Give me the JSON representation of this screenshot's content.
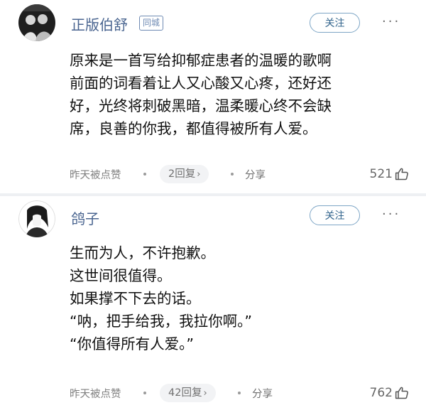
{
  "comments": [
    {
      "username": "正版伯舒",
      "badge": "同城",
      "follow_label": "关注",
      "more_icon": "more-dots-icon",
      "text_lines": [
        "原来是一首写给抑郁症患者的温暖的歌啊",
        "前面的词看着让人又心酸又心疼，还好还",
        "好，光终将刺破黑暗，温柔暖心终不会缺",
        "席，良善的你我，都值得被所有人爱。"
      ],
      "time": "昨天被点赞",
      "replies": "2回复",
      "share_label": "分享",
      "likes": "521",
      "like_icon": "thumbs-up-icon"
    },
    {
      "username": "鸽子",
      "follow_label": "关注",
      "more_icon": "more-dots-icon",
      "text_lines": [
        "生而为人，不许抱歉。",
        "这世间很值得。",
        "如果撑不下去的话。",
        "“呐，把手给我，我拉你啊。”",
        "“你值得所有人爱。”"
      ],
      "time": "昨天被点赞",
      "replies": "42回复",
      "share_label": "分享",
      "likes": "762",
      "like_icon": "thumbs-up-icon"
    }
  ],
  "colors": {
    "username": "#4a6590",
    "follow_border": "#7ea6c6",
    "meta_text": "#808080",
    "divider": "#eef0f3"
  }
}
